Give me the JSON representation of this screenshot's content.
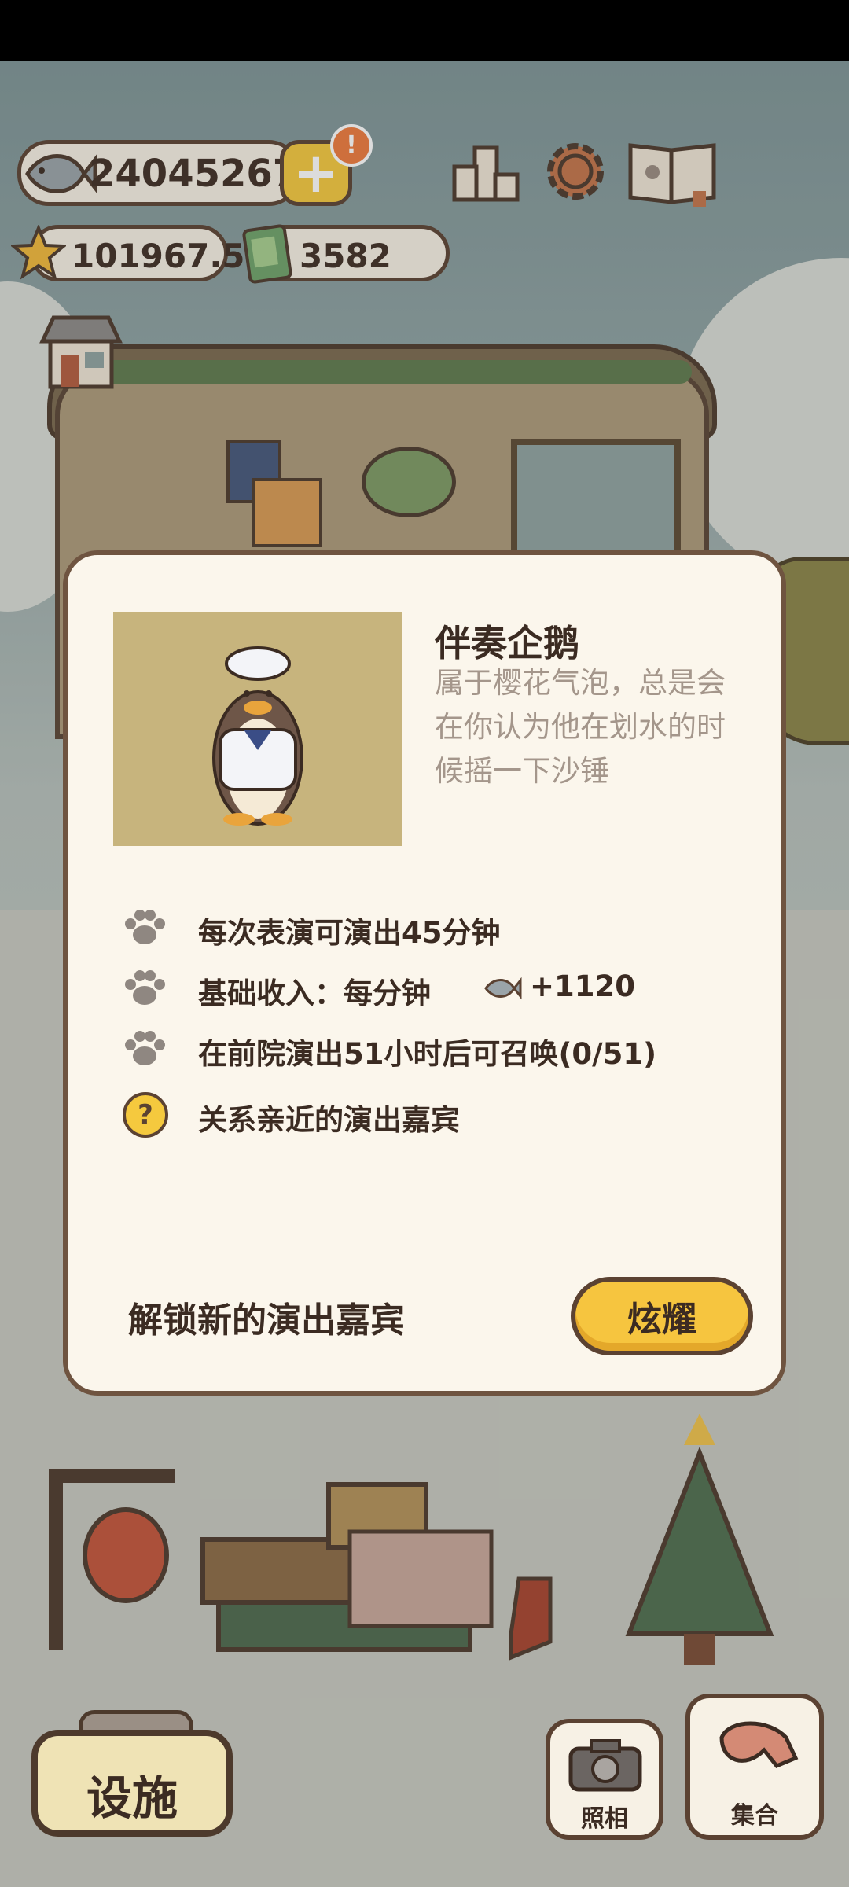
{
  "hud": {
    "fish_count": "24045267",
    "alert_badge": "!",
    "star_count": "101967.5",
    "ticket_count": "3582",
    "plus_label": "+"
  },
  "dialog": {
    "character_name": "伴奏企鹅",
    "character_description": "属于樱花气泡，总是会在你认为他在划水的时候摇一下沙锤",
    "info": [
      {
        "icon": "paw-icon",
        "text": "每次表演可演出45分钟"
      },
      {
        "icon": "paw-icon",
        "text": "基础收入：每分钟",
        "fish_icon": "fish-icon",
        "value": "+1120"
      },
      {
        "icon": "paw-icon",
        "text": "在前院演出51小时后可召唤(0/51)"
      },
      {
        "icon": "question-icon",
        "text": "关系亲近的演出嘉宾"
      }
    ],
    "question_mark": "?",
    "unlock_text": "解锁新的演出嘉宾",
    "show_button": "炫耀"
  },
  "bottom": {
    "facilities_button": "设施",
    "photo_button": "照相",
    "gather_button": "集合"
  },
  "colors": {
    "accent_yellow": "#f6c53f",
    "outline_brown": "#5b4232",
    "panel_cream": "#fbf6ec",
    "muted_text": "#a4968b"
  }
}
